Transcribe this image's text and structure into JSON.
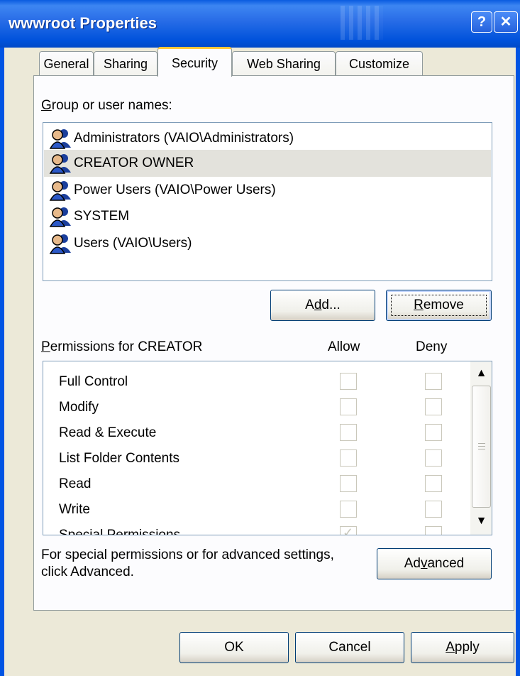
{
  "window": {
    "title": "wwwroot Properties",
    "help_glyph": "?",
    "close_glyph": "✕"
  },
  "tabs": [
    {
      "label": "General"
    },
    {
      "label": "Sharing"
    },
    {
      "label": "Security",
      "active": true
    },
    {
      "label": "Web Sharing"
    },
    {
      "label": "Customize"
    }
  ],
  "security": {
    "group_label_hotkey": "G",
    "group_label_rest": "roup or user names:",
    "users": [
      {
        "name": "Administrators (VAIO\\Administrators)"
      },
      {
        "name": "CREATOR OWNER",
        "selected": true
      },
      {
        "name": "Power Users (VAIO\\Power Users)"
      },
      {
        "name": "SYSTEM"
      },
      {
        "name": "Users (VAIO\\Users)"
      }
    ],
    "add_button": {
      "pre": "A",
      "hotkey": "d",
      "post": "d..."
    },
    "remove_button": {
      "hotkey": "R",
      "post": "emove"
    },
    "permissions_label_hotkey": "P",
    "permissions_label_rest": "ermissions for CREATOR",
    "allow_header": "Allow",
    "deny_header": "Deny",
    "permissions": [
      {
        "name": "Full Control",
        "allow": false,
        "deny": false
      },
      {
        "name": "Modify",
        "allow": false,
        "deny": false
      },
      {
        "name": "Read & Execute",
        "allow": false,
        "deny": false
      },
      {
        "name": "List Folder Contents",
        "allow": false,
        "deny": false
      },
      {
        "name": "Read",
        "allow": false,
        "deny": false
      },
      {
        "name": "Write",
        "allow": false,
        "deny": false
      },
      {
        "name": "Special Permissions",
        "allow": true,
        "deny": false
      }
    ],
    "advanced_note_line1": "For special permissions or for advanced settings,",
    "advanced_note_line2": "click Advanced.",
    "advanced_button": {
      "pre": "Ad",
      "hotkey": "v",
      "post": "anced"
    }
  },
  "footer": {
    "ok_label": "OK",
    "cancel_label": "Cancel",
    "apply_button": {
      "hotkey": "A",
      "post": "pply"
    }
  },
  "colors": {
    "titlebar": "#0054e3",
    "selection": "#e3e2dc",
    "dialog_bg": "#ece9d8",
    "active_tab_accent": "#ffc83c"
  }
}
